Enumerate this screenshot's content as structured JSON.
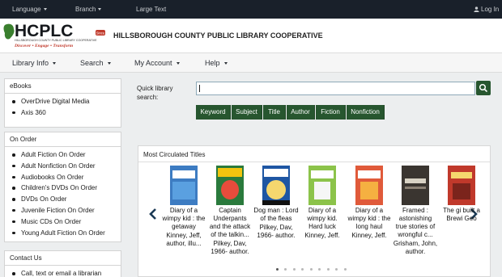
{
  "topbar": {
    "language": "Language",
    "branch": "Branch",
    "large_text": "Large Text",
    "login": "Log In"
  },
  "header": {
    "logo_text": "HCPLC",
    "logo_badge": "Since",
    "logo_subtitle": "HILLSBOROUGH COUNTY PUBLIC LIBRARY COOPERATIVE",
    "logo_tagline": "Discover • Engage • Transform",
    "site_title": "HILLSBOROUGH COUNTY PUBLIC LIBRARY COOPERATIVE"
  },
  "nav": {
    "library_info": "Library Info",
    "search": "Search",
    "my_account": "My Account",
    "help": "Help"
  },
  "sidebar": {
    "ebooks": {
      "title": "eBooks",
      "items": [
        "OverDrive Digital Media",
        "Axis 360"
      ]
    },
    "on_order": {
      "title": "On Order",
      "items": [
        "Adult Fiction On Order",
        "Adult Nonfiction On Order",
        "Audiobooks On Order",
        "Children's DVDs On Order",
        "DVDs On Order",
        "Juvenile Fiction On Order",
        "Music CDs On Order",
        "Young Adult Fiction On Order"
      ]
    },
    "contact": {
      "title": "Contact Us",
      "items": [
        "Call, text or email a librarian"
      ]
    }
  },
  "search": {
    "label": "Quick library search:",
    "value": "",
    "filters": [
      "Keyword",
      "Subject",
      "Title",
      "Author",
      "Fiction",
      "Nonfiction"
    ]
  },
  "carousel": {
    "title": "Most Circulated Titles",
    "books": [
      {
        "title": "Diary of a wimpy kid : the getaway",
        "author": "Kinney, Jeff, author, illu...",
        "cover": "#3d7cc2"
      },
      {
        "title": "Captain Underpants and the attack of the talkin...",
        "author": "Pilkey, Dav, 1966- author.",
        "cover": "#2a7a3c"
      },
      {
        "title": "Dog man : Lord of the fleas",
        "author": "Pilkey, Dav, 1966- author.",
        "cover": "#1e56a3"
      },
      {
        "title": "Diary of a wimpy kid. Hard luck",
        "author": "Kinney, Jeff.",
        "cover": "#8cc34a"
      },
      {
        "title": "Diary of a wimpy kid : the long haul",
        "author": "Kinney, Jeff.",
        "cover": "#e05a3a"
      },
      {
        "title": "Framed : astonishing true stories of wrongful c...",
        "author": "Grisham, John, author.",
        "cover": "#3a3530"
      },
      {
        "title": "The gi built a Brewi Geo",
        "author": "",
        "cover": "#c0392b"
      }
    ],
    "dots": 9,
    "active_dot": 0
  },
  "colors": {
    "topbar": "#19202a",
    "accent_green": "#27562f",
    "link": "#1a1a1a"
  }
}
